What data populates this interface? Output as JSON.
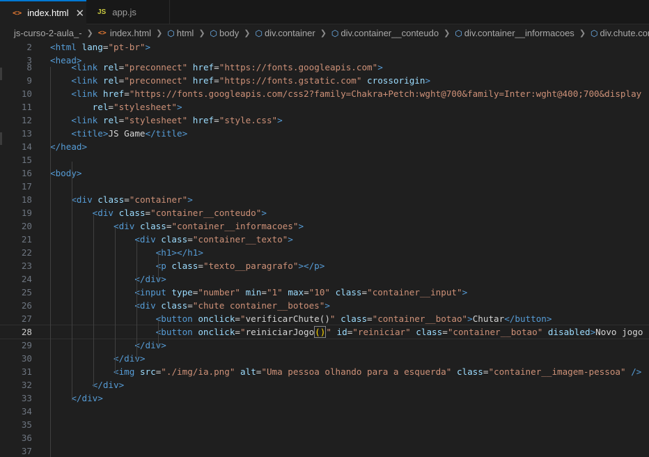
{
  "tabs": [
    {
      "label": "index.html",
      "icon": "html-icon",
      "active": true
    },
    {
      "label": "app.js",
      "icon": "js-icon",
      "active": false
    }
  ],
  "breadcrumb": [
    "js-curso-2-aula_-",
    "index.html",
    "html",
    "body",
    "div.container",
    "div.container__conteudo",
    "div.container__informacoes",
    "div.chute.container__botoes"
  ],
  "colors": {
    "tag": "#569cd6",
    "attribute": "#9cdcfe",
    "string": "#ce9178",
    "text": "#d4d4d4",
    "accent": "#0078d4",
    "line_number": "#6e7681"
  },
  "editor": {
    "sticky_lines": [
      {
        "n": "2",
        "tokens": [
          [
            "tag",
            "<html"
          ],
          [
            "txt",
            " "
          ],
          [
            "attr",
            "lang"
          ],
          [
            "txt",
            "="
          ],
          [
            "str",
            "\"pt-br\""
          ],
          [
            "tag",
            ">"
          ]
        ]
      },
      {
        "n": "3",
        "tokens": [
          [
            "tag",
            "<head>"
          ]
        ]
      }
    ],
    "lines": [
      {
        "n": "8",
        "tokens": [
          [
            "txt",
            "    "
          ],
          [
            "tag",
            "<link"
          ],
          [
            "txt",
            " "
          ],
          [
            "attr",
            "rel"
          ],
          [
            "txt",
            "="
          ],
          [
            "str",
            "\"preconnect\""
          ],
          [
            "txt",
            " "
          ],
          [
            "attr",
            "href"
          ],
          [
            "txt",
            "="
          ],
          [
            "str",
            "\"https://fonts.googleapis.com\""
          ],
          [
            "tag",
            ">"
          ]
        ]
      },
      {
        "n": "9",
        "tokens": [
          [
            "txt",
            "    "
          ],
          [
            "tag",
            "<link"
          ],
          [
            "txt",
            " "
          ],
          [
            "attr",
            "rel"
          ],
          [
            "txt",
            "="
          ],
          [
            "str",
            "\"preconnect\""
          ],
          [
            "txt",
            " "
          ],
          [
            "attr",
            "href"
          ],
          [
            "txt",
            "="
          ],
          [
            "str",
            "\"https://fonts.gstatic.com\""
          ],
          [
            "txt",
            " "
          ],
          [
            "attr",
            "crossorigin"
          ],
          [
            "tag",
            ">"
          ]
        ]
      },
      {
        "n": "10",
        "tokens": [
          [
            "txt",
            "    "
          ],
          [
            "tag",
            "<link"
          ],
          [
            "txt",
            " "
          ],
          [
            "attr",
            "href"
          ],
          [
            "txt",
            "="
          ],
          [
            "str",
            "\"https://fonts.googleapis.com/css2?family=Chakra+Petch:wght@700&family=Inter:wght@400;700&display"
          ]
        ]
      },
      {
        "n": "11",
        "tokens": [
          [
            "txt",
            "        "
          ],
          [
            "attr",
            "rel"
          ],
          [
            "txt",
            "="
          ],
          [
            "str",
            "\"stylesheet\""
          ],
          [
            "tag",
            ">"
          ]
        ]
      },
      {
        "n": "12",
        "tokens": [
          [
            "txt",
            "    "
          ],
          [
            "tag",
            "<link"
          ],
          [
            "txt",
            " "
          ],
          [
            "attr",
            "rel"
          ],
          [
            "txt",
            "="
          ],
          [
            "str",
            "\"stylesheet\""
          ],
          [
            "txt",
            " "
          ],
          [
            "attr",
            "href"
          ],
          [
            "txt",
            "="
          ],
          [
            "str",
            "\"style.css\""
          ],
          [
            "tag",
            ">"
          ]
        ]
      },
      {
        "n": "13",
        "tokens": [
          [
            "txt",
            "    "
          ],
          [
            "tag",
            "<title>"
          ],
          [
            "txt",
            "JS Game"
          ],
          [
            "tag",
            "</title>"
          ]
        ]
      },
      {
        "n": "14",
        "tokens": [
          [
            "tag",
            "</head>"
          ]
        ]
      },
      {
        "n": "15",
        "tokens": []
      },
      {
        "n": "16",
        "tokens": [
          [
            "tag",
            "<body>"
          ]
        ]
      },
      {
        "n": "17",
        "tokens": []
      },
      {
        "n": "18",
        "tokens": [
          [
            "txt",
            "    "
          ],
          [
            "tag",
            "<div"
          ],
          [
            "txt",
            " "
          ],
          [
            "attr",
            "class"
          ],
          [
            "txt",
            "="
          ],
          [
            "str",
            "\"container\""
          ],
          [
            "tag",
            ">"
          ]
        ]
      },
      {
        "n": "19",
        "tokens": [
          [
            "txt",
            "        "
          ],
          [
            "tag",
            "<div"
          ],
          [
            "txt",
            " "
          ],
          [
            "attr",
            "class"
          ],
          [
            "txt",
            "="
          ],
          [
            "str",
            "\"container__conteudo\""
          ],
          [
            "tag",
            ">"
          ]
        ]
      },
      {
        "n": "20",
        "tokens": [
          [
            "txt",
            "            "
          ],
          [
            "tag",
            "<div"
          ],
          [
            "txt",
            " "
          ],
          [
            "attr",
            "class"
          ],
          [
            "txt",
            "="
          ],
          [
            "str",
            "\"container__informacoes\""
          ],
          [
            "tag",
            ">"
          ]
        ]
      },
      {
        "n": "21",
        "tokens": [
          [
            "txt",
            "                "
          ],
          [
            "tag",
            "<div"
          ],
          [
            "txt",
            " "
          ],
          [
            "attr",
            "class"
          ],
          [
            "txt",
            "="
          ],
          [
            "str",
            "\"container__texto\""
          ],
          [
            "tag",
            ">"
          ]
        ]
      },
      {
        "n": "22",
        "tokens": [
          [
            "txt",
            "                    "
          ],
          [
            "tag",
            "<h1></h1>"
          ]
        ]
      },
      {
        "n": "23",
        "tokens": [
          [
            "txt",
            "                    "
          ],
          [
            "tag",
            "<p"
          ],
          [
            "txt",
            " "
          ],
          [
            "attr",
            "class"
          ],
          [
            "txt",
            "="
          ],
          [
            "str",
            "\"texto__paragrafo\""
          ],
          [
            "tag",
            "></p>"
          ]
        ]
      },
      {
        "n": "24",
        "tokens": [
          [
            "txt",
            "                "
          ],
          [
            "tag",
            "</div>"
          ]
        ]
      },
      {
        "n": "25",
        "tokens": [
          [
            "txt",
            "                "
          ],
          [
            "tag",
            "<input"
          ],
          [
            "txt",
            " "
          ],
          [
            "attr",
            "type"
          ],
          [
            "txt",
            "="
          ],
          [
            "str",
            "\"number\""
          ],
          [
            "txt",
            " "
          ],
          [
            "attr",
            "min"
          ],
          [
            "txt",
            "="
          ],
          [
            "str",
            "\"1\""
          ],
          [
            "txt",
            " "
          ],
          [
            "attr",
            "max"
          ],
          [
            "txt",
            "="
          ],
          [
            "str",
            "\"10\""
          ],
          [
            "txt",
            " "
          ],
          [
            "attr",
            "class"
          ],
          [
            "txt",
            "="
          ],
          [
            "str",
            "\"container__input\""
          ],
          [
            "tag",
            ">"
          ]
        ]
      },
      {
        "n": "26",
        "tokens": [
          [
            "txt",
            "                "
          ],
          [
            "tag",
            "<div"
          ],
          [
            "txt",
            " "
          ],
          [
            "attr",
            "class"
          ],
          [
            "txt",
            "="
          ],
          [
            "str",
            "\"chute container__botoes\""
          ],
          [
            "tag",
            ">"
          ]
        ]
      },
      {
        "n": "27",
        "tokens": [
          [
            "txt",
            "                    "
          ],
          [
            "tag",
            "<button"
          ],
          [
            "txt",
            " "
          ],
          [
            "attr",
            "onclick"
          ],
          [
            "txt",
            "="
          ],
          [
            "str",
            "\""
          ],
          [
            "txt",
            "verificarChute()"
          ],
          [
            "str",
            "\""
          ],
          [
            "txt",
            " "
          ],
          [
            "attr",
            "class"
          ],
          [
            "txt",
            "="
          ],
          [
            "str",
            "\"container__botao\""
          ],
          [
            "tag",
            ">"
          ],
          [
            "txt",
            "Chutar"
          ],
          [
            "tag",
            "</button>"
          ]
        ]
      },
      {
        "n": "28",
        "current": true,
        "tokens": [
          [
            "txt",
            "                    "
          ],
          [
            "tag",
            "<button"
          ],
          [
            "txt",
            " "
          ],
          [
            "attr",
            "onclick"
          ],
          [
            "txt",
            "="
          ],
          [
            "str",
            "\""
          ],
          [
            "txt",
            "reiniciarJogo"
          ],
          [
            "br",
            "()"
          ],
          [
            "str",
            "\""
          ],
          [
            "txt",
            " "
          ],
          [
            "attr",
            "id"
          ],
          [
            "txt",
            "="
          ],
          [
            "str",
            "\"reiniciar\""
          ],
          [
            "txt",
            " "
          ],
          [
            "attr",
            "class"
          ],
          [
            "txt",
            "="
          ],
          [
            "str",
            "\"container__botao\""
          ],
          [
            "txt",
            " "
          ],
          [
            "attr",
            "disabled"
          ],
          [
            "tag",
            ">"
          ],
          [
            "txt",
            "Novo jogo"
          ]
        ]
      },
      {
        "n": "29",
        "tokens": [
          [
            "txt",
            "                "
          ],
          [
            "tag",
            "</div>"
          ]
        ]
      },
      {
        "n": "30",
        "tokens": [
          [
            "txt",
            "            "
          ],
          [
            "tag",
            "</div>"
          ]
        ]
      },
      {
        "n": "31",
        "tokens": [
          [
            "txt",
            "            "
          ],
          [
            "tag",
            "<img"
          ],
          [
            "txt",
            " "
          ],
          [
            "attr",
            "src"
          ],
          [
            "txt",
            "="
          ],
          [
            "str",
            "\"./img/ia.png\""
          ],
          [
            "txt",
            " "
          ],
          [
            "attr",
            "alt"
          ],
          [
            "txt",
            "="
          ],
          [
            "str",
            "\"Uma pessoa olhando para a esquerda\""
          ],
          [
            "txt",
            " "
          ],
          [
            "attr",
            "class"
          ],
          [
            "txt",
            "="
          ],
          [
            "str",
            "\"container__imagem-pessoa\""
          ],
          [
            "txt",
            " "
          ],
          [
            "tag",
            "/>"
          ]
        ]
      },
      {
        "n": "32",
        "tokens": [
          [
            "txt",
            "        "
          ],
          [
            "tag",
            "</div>"
          ]
        ]
      },
      {
        "n": "33",
        "tokens": [
          [
            "txt",
            "    "
          ],
          [
            "tag",
            "</div>"
          ]
        ]
      },
      {
        "n": "34",
        "tokens": []
      },
      {
        "n": "35",
        "tokens": []
      },
      {
        "n": "36",
        "tokens": []
      },
      {
        "n": "37",
        "tokens": []
      }
    ]
  }
}
